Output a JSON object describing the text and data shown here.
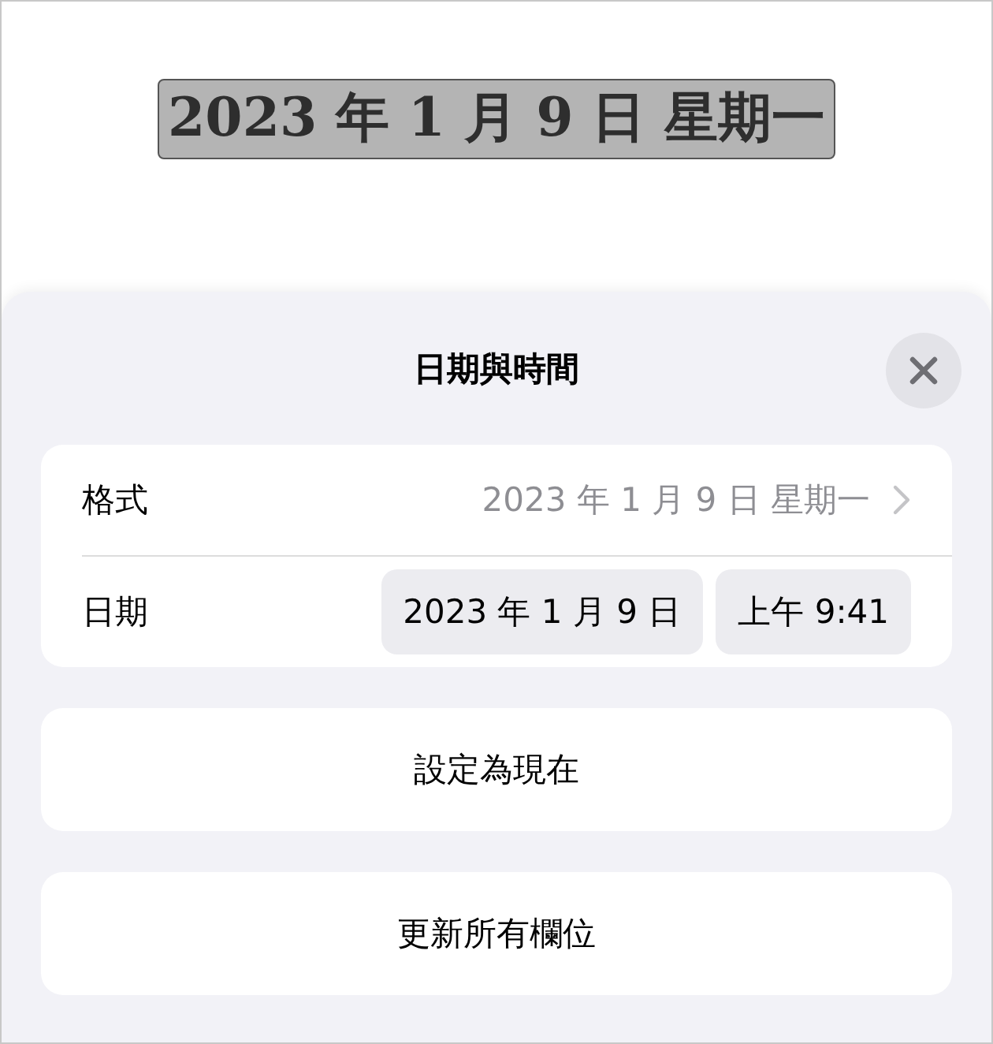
{
  "document": {
    "selected_text": "2023 年 1 月 9 日 星期一"
  },
  "sheet": {
    "title": "日期與時間",
    "rows": [
      {
        "kind": "format",
        "label": "格式",
        "value": "2023 年 1 月 9 日 星期一"
      },
      {
        "kind": "date",
        "label": "日期",
        "date": "2023 年 1 月 9 日",
        "time": "上午 9:41"
      }
    ],
    "buttons": [
      "設定為現在",
      "更新所有欄位"
    ]
  }
}
